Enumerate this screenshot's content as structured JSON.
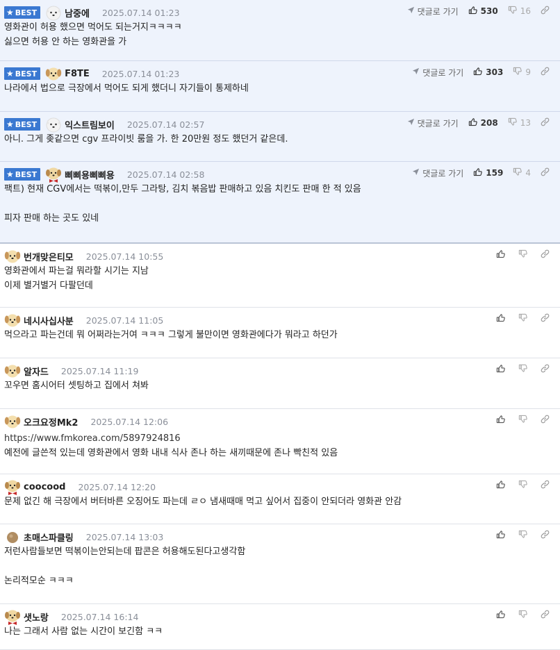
{
  "labels": {
    "best": "BEST",
    "reply": "댓글로 가기"
  },
  "colors": {
    "best_bg": "#eef3fc",
    "badge": "#3a78d1"
  },
  "comments": [
    {
      "best": true,
      "avatar": "white-dog-avatar-icon",
      "nick": "남중에",
      "date": "2025.07.14 01:23",
      "reply": "댓글로 가기",
      "up": "530",
      "down": "16",
      "lines": [
        "영화관이 허용 했으면 먹어도 되는거지ㅋㅋㅋㅋ",
        "싫으면 허용 안 하는 영화관을 가"
      ]
    },
    {
      "best": true,
      "avatar": "yellow-dog-avatar-icon",
      "nick": "F8TE",
      "date": "2025.07.14 01:23",
      "reply": "댓글로 가기",
      "up": "303",
      "down": "9",
      "lines": [
        "나라에서 법으로 극장에서 먹어도 되게 했더니 자기들이 통제하네"
      ]
    },
    {
      "best": true,
      "avatar": "white-dog-avatar-icon",
      "nick": "익스트림보이",
      "date": "2025.07.14 02:57",
      "reply": "댓글로 가기",
      "up": "208",
      "down": "13",
      "lines": [
        "아니. 그게 좆같으면 cgv 프라이빗 룸을 가. 한 20만원 정도 했던거 같은데."
      ]
    },
    {
      "best": true,
      "avatar": "bowtie-dog-avatar-icon",
      "nick": "삐삐용삐삐용",
      "date": "2025.07.14 02:58",
      "reply": "댓글로 가기",
      "up": "159",
      "down": "4",
      "lines": [
        "팩트) 현재 CGV에서는 떡볶이,만두 그라탕, 김치 볶음밥 판매하고 있음 치킨도 판매 한 적 있음",
        "",
        "피자 판매 하는 곳도 있네"
      ]
    },
    {
      "best": false,
      "avatar": "yellow-dog-avatar-icon",
      "nick": "번개맞은티모",
      "date": "2025.07.14 10:55",
      "lines": [
        "영화관에서 파는걸 뭐라할 시기는 지남",
        "이제 별거별거 다팔던데"
      ]
    },
    {
      "best": false,
      "avatar": "yellow-dog-avatar-icon",
      "nick": "네시사십사분",
      "date": "2025.07.14 11:05",
      "lines": [
        "먹으라고 파는건데 뭐 어쩌라는거여 ㅋㅋㅋ 그렇게 불만이면 영화관에다가 뭐라고 하던가"
      ]
    },
    {
      "best": false,
      "avatar": "yellow-dog-avatar-icon",
      "nick": "알자드",
      "date": "2025.07.14 11:19",
      "lines": [
        "꼬우면 홈시어터 셋팅하고 집에서 쳐봐"
      ]
    },
    {
      "best": false,
      "avatar": "yellow-dog-avatar-icon",
      "nick": "오크요정Mk2",
      "date": "2025.07.14 12:06",
      "link": "https://www.fmkorea.com/5897924816",
      "lines": [
        "예전에 글쓴적 있는데 영화관에서 영화 내내 식사 존나 하는 새끼때문에 존나 빡친적 있음"
      ]
    },
    {
      "best": false,
      "avatar": "bowtie-dog-avatar-icon",
      "nick": "coocood",
      "date": "2025.07.14 12:20",
      "lines": [
        "문제 없긴 해 극장에서 버터바른 오징어도 파는데 ㄹㅇ 냄새때매 먹고 싶어서 집중이 안되더라 영화관 안감"
      ]
    },
    {
      "best": false,
      "avatar": "brown-ball-avatar-icon",
      "nick": "초매스파클링",
      "date": "2025.07.14 13:03",
      "lines": [
        "저런사람들보면 떡볶이는안되는데 팝콘은 허용해도된다고생각함",
        "",
        "논리적모순 ㅋㅋㅋ"
      ]
    },
    {
      "best": false,
      "avatar": "bowtie-dog-avatar-icon",
      "nick": "샛노랑",
      "date": "2025.07.14 16:14",
      "lines": [
        "나는 그래서 사람 없는 시간이 보긴함 ㅋㅋ"
      ]
    }
  ]
}
